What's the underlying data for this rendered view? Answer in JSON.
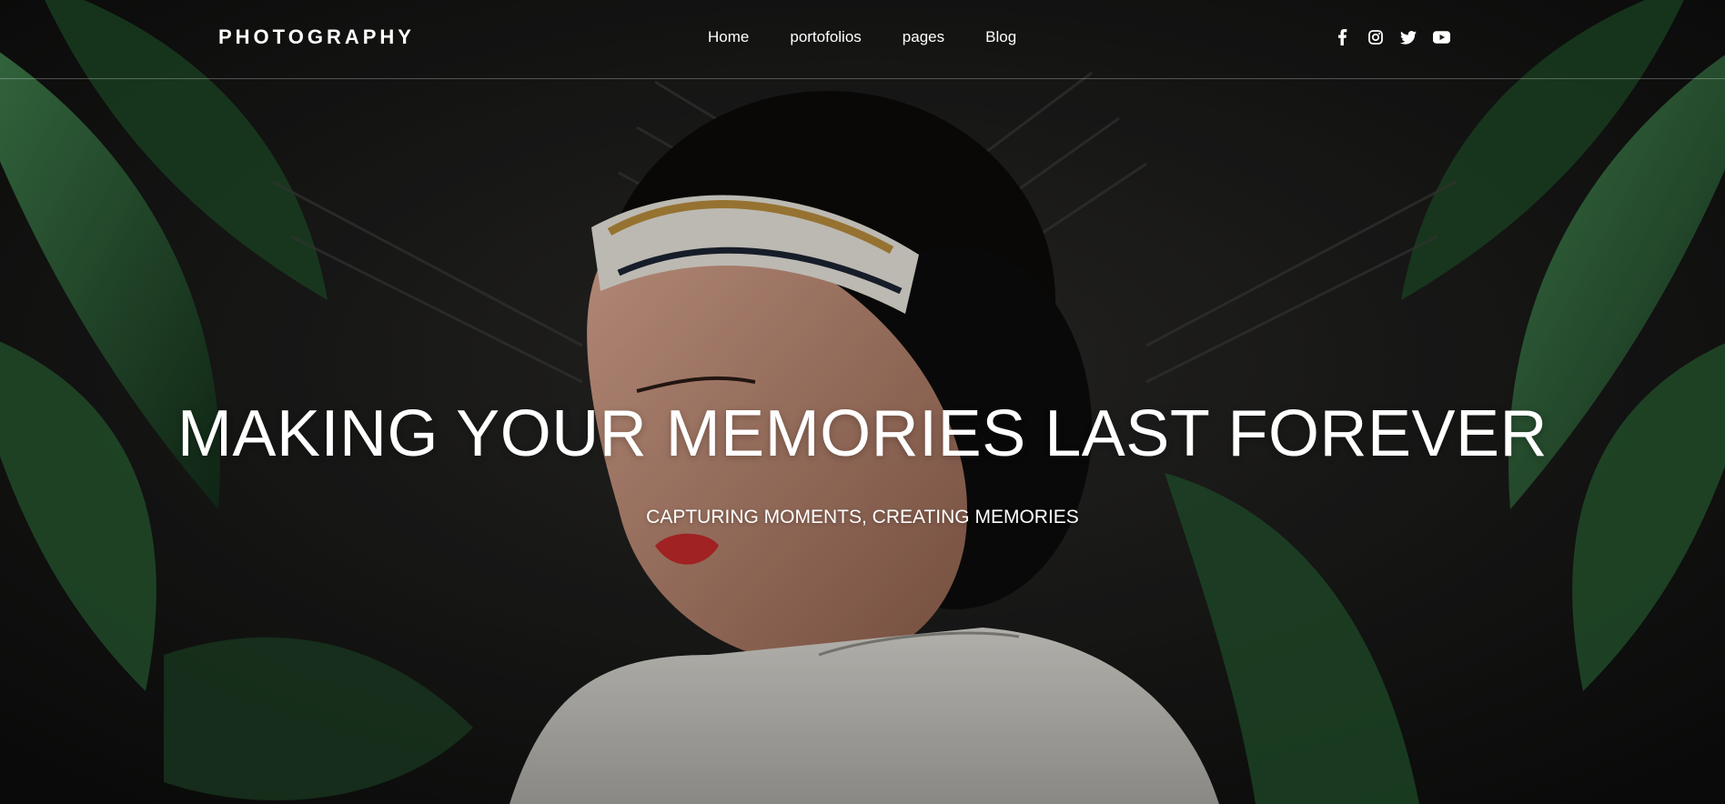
{
  "header": {
    "logo": "PHOTOGRAPHY",
    "nav": [
      {
        "label": "Home"
      },
      {
        "label": "portofolios"
      },
      {
        "label": "pages"
      },
      {
        "label": "Blog"
      }
    ],
    "social_icons": [
      "facebook-icon",
      "instagram-icon",
      "twitter-icon",
      "youtube-icon"
    ]
  },
  "hero": {
    "headline": "MAKING YOUR MEMORIES LAST FOREVER",
    "subheadline": "CAPTURING MOMENTS, CREATING MEMORIES"
  },
  "colors": {
    "text": "#ffffff",
    "leaf_green": "#2f7a3e",
    "background_dark": "#1a1a1a",
    "lip_red": "#c42a2a"
  }
}
